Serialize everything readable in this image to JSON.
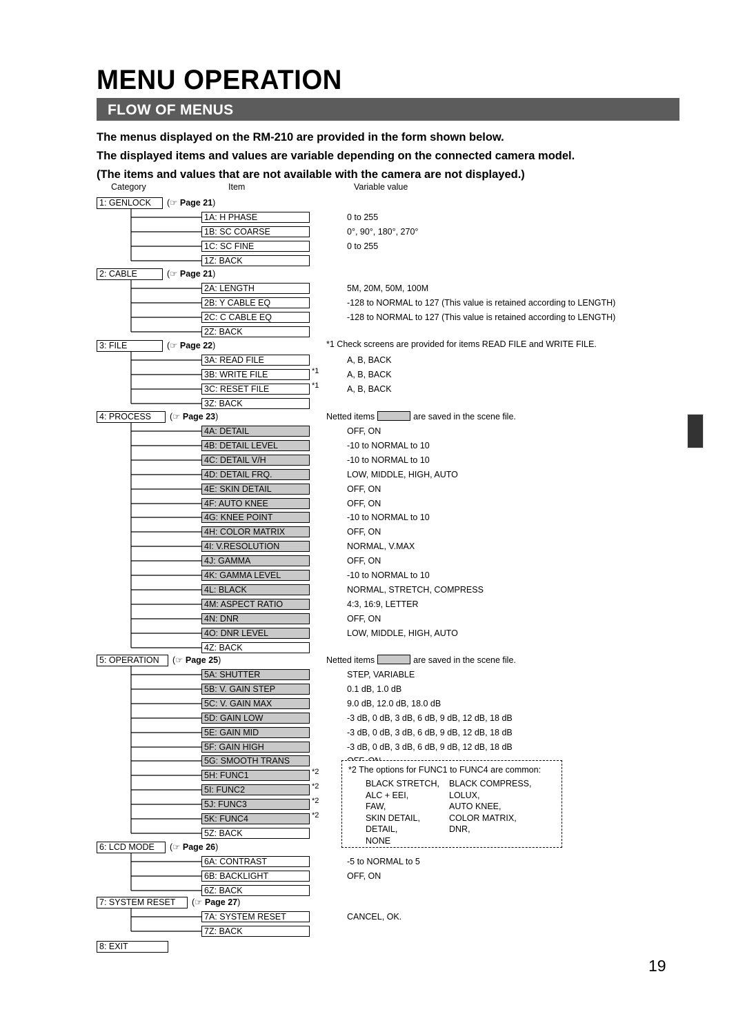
{
  "page": {
    "title": "MENU OPERATION",
    "section_bar_label": "FLOW OF MENUS",
    "section_bar_color": "#5c5c5c",
    "page_number": "19",
    "intro_lines": [
      "The menus displayed on the RM-210 are provided in the form shown below.",
      "The displayed items and values are variable depending on the connected camera model.",
      "(The items and values that are not available with the camera are not displayed.)"
    ],
    "column_headers": {
      "category": "Category",
      "item": "Item",
      "value": "Variable value"
    },
    "netted_colors": {
      "netted_fill": "#c9c9c9",
      "box_border": "#000000"
    }
  },
  "notes": {
    "file_note": "*1 Check screens are provided for items READ FILE and WRITE FILE.",
    "netted_prefix": "Netted items",
    "netted_suffix": "are saved in the scene file.",
    "func_note": {
      "marker": "*2",
      "title": "The options for FUNC1 to FUNC4 are common:",
      "col_a": [
        "BLACK STRETCH,",
        "ALC + EEI,",
        "FAW,",
        "SKIN DETAIL,",
        "DETAIL,",
        "NONE"
      ],
      "col_b": [
        "BLACK COMPRESS,",
        "LOLUX,",
        "AUTO KNEE,",
        "COLOR MATRIX,",
        "DNR,",
        ""
      ]
    }
  },
  "reference_icon": "pointing-hand-icon",
  "menu": [
    {
      "category": "1: GENLOCK",
      "page_ref_prefix": "(",
      "page_ref": "Page 21",
      "page_ref_suffix": ")",
      "items": [
        {
          "label": "1A: H PHASE",
          "value": "0 to 255",
          "netted": false,
          "mark": ""
        },
        {
          "label": "1B: SC COARSE",
          "value": "0°, 90°, 180°, 270°",
          "netted": false,
          "mark": ""
        },
        {
          "label": "1C: SC FINE",
          "value": "0 to 255",
          "netted": false,
          "mark": ""
        },
        {
          "label": "1Z: BACK",
          "value": "",
          "netted": false,
          "mark": ""
        }
      ]
    },
    {
      "category": "2: CABLE",
      "page_ref_prefix": "(",
      "page_ref": "Page 21",
      "page_ref_suffix": ")",
      "items": [
        {
          "label": "2A: LENGTH",
          "value": "5M, 20M, 50M, 100M",
          "netted": false,
          "mark": ""
        },
        {
          "label": "2B: Y CABLE EQ",
          "value": "-128 to NORMAL to 127 (This value is retained according to LENGTH)",
          "netted": false,
          "mark": ""
        },
        {
          "label": "2C: C CABLE EQ",
          "value": "-128 to NORMAL to 127 (This value is retained according to LENGTH)",
          "netted": false,
          "mark": ""
        },
        {
          "label": "2Z: BACK",
          "value": "",
          "netted": false,
          "mark": ""
        }
      ]
    },
    {
      "category": "3: FILE",
      "page_ref_prefix": "(",
      "page_ref": "Page 22",
      "page_ref_suffix": ")",
      "items": [
        {
          "label": "3A: READ FILE",
          "value": "A, B, BACK",
          "netted": false,
          "mark": ""
        },
        {
          "label": "3B: WRITE FILE",
          "value": "A, B, BACK",
          "netted": false,
          "mark": "*1"
        },
        {
          "label": "3C: RESET FILE",
          "value": "A, B, BACK",
          "netted": false,
          "mark": "*1"
        },
        {
          "label": "3Z: BACK",
          "value": "",
          "netted": false,
          "mark": ""
        }
      ]
    },
    {
      "category": "4: PROCESS",
      "page_ref_prefix": "(",
      "page_ref": "Page 23",
      "page_ref_suffix": ")",
      "items": [
        {
          "label": "4A: DETAIL",
          "value": "OFF, ON",
          "netted": true,
          "mark": ""
        },
        {
          "label": "4B: DETAIL LEVEL",
          "value": "-10 to NORMAL to 10",
          "netted": true,
          "mark": ""
        },
        {
          "label": "4C: DETAIL V/H",
          "value": "-10 to NORMAL to 10",
          "netted": true,
          "mark": ""
        },
        {
          "label": "4D: DETAIL FRQ.",
          "value": "LOW, MIDDLE, HIGH, AUTO",
          "netted": true,
          "mark": ""
        },
        {
          "label": "4E: SKIN DETAIL",
          "value": "OFF, ON",
          "netted": true,
          "mark": ""
        },
        {
          "label": "4F: AUTO KNEE",
          "value": "OFF, ON",
          "netted": true,
          "mark": ""
        },
        {
          "label": "4G: KNEE POINT",
          "value": "-10 to NORMAL to 10",
          "netted": true,
          "mark": ""
        },
        {
          "label": "4H: COLOR MATRIX",
          "value": "OFF, ON",
          "netted": true,
          "mark": ""
        },
        {
          "label": "4I: V.RESOLUTION",
          "value": "NORMAL, V.MAX",
          "netted": true,
          "mark": ""
        },
        {
          "label": "4J: GAMMA",
          "value": "OFF, ON",
          "netted": true,
          "mark": ""
        },
        {
          "label": "4K: GAMMA LEVEL",
          "value": "-10 to NORMAL to 10",
          "netted": true,
          "mark": ""
        },
        {
          "label": "4L: BLACK",
          "value": "NORMAL, STRETCH, COMPRESS",
          "netted": true,
          "mark": ""
        },
        {
          "label": "4M: ASPECT RATIO",
          "value": "4:3, 16:9, LETTER",
          "netted": true,
          "mark": ""
        },
        {
          "label": "4N: DNR",
          "value": "OFF, ON",
          "netted": true,
          "mark": ""
        },
        {
          "label": "4O: DNR LEVEL",
          "value": "LOW, MIDDLE, HIGH, AUTO",
          "netted": true,
          "mark": ""
        },
        {
          "label": "4Z: BACK",
          "value": "",
          "netted": false,
          "mark": ""
        }
      ]
    },
    {
      "category": "5: OPERATION",
      "page_ref_prefix": "(",
      "page_ref": "Page 25",
      "page_ref_suffix": ")",
      "items": [
        {
          "label": "5A: SHUTTER",
          "value": "STEP, VARIABLE",
          "netted": true,
          "mark": ""
        },
        {
          "label": "5B: V. GAIN STEP",
          "value": "0.1 dB, 1.0 dB",
          "netted": true,
          "mark": ""
        },
        {
          "label": "5C: V. GAIN MAX",
          "value": "9.0 dB, 12.0 dB, 18.0 dB",
          "netted": true,
          "mark": ""
        },
        {
          "label": "5D: GAIN LOW",
          "value": "-3 dB, 0 dB, 3 dB, 6 dB, 9 dB, 12 dB, 18 dB",
          "netted": true,
          "mark": ""
        },
        {
          "label": "5E: GAIN MID",
          "value": "-3 dB, 0 dB, 3 dB, 6 dB, 9 dB, 12 dB, 18 dB",
          "netted": true,
          "mark": ""
        },
        {
          "label": "5F: GAIN HIGH",
          "value": "-3 dB, 0 dB, 3 dB, 6 dB, 9 dB, 12 dB, 18 dB",
          "netted": true,
          "mark": ""
        },
        {
          "label": "5G: SMOOTH TRANS",
          "value": "OFF, ON",
          "netted": true,
          "mark": ""
        },
        {
          "label": "5H: FUNC1",
          "value": "",
          "netted": true,
          "mark": "*2"
        },
        {
          "label": "5I: FUNC2",
          "value": "",
          "netted": true,
          "mark": "*2"
        },
        {
          "label": "5J: FUNC3",
          "value": "",
          "netted": true,
          "mark": "*2"
        },
        {
          "label": "5K: FUNC4",
          "value": "",
          "netted": true,
          "mark": "*2"
        },
        {
          "label": "5Z: BACK",
          "value": "",
          "netted": false,
          "mark": ""
        }
      ]
    },
    {
      "category": "6: LCD MODE",
      "page_ref_prefix": "(",
      "page_ref": "Page 26",
      "page_ref_suffix": ")",
      "items": [
        {
          "label": "6A: CONTRAST",
          "value": "-5 to NORMAL to 5",
          "netted": false,
          "mark": ""
        },
        {
          "label": "6B: BACKLIGHT",
          "value": "OFF, ON",
          "netted": false,
          "mark": ""
        },
        {
          "label": "6Z: BACK",
          "value": "",
          "netted": false,
          "mark": ""
        }
      ]
    },
    {
      "category": "7: SYSTEM RESET",
      "page_ref_prefix": "(",
      "page_ref": "Page 27",
      "page_ref_suffix": ")",
      "items": [
        {
          "label": "7A: SYSTEM RESET",
          "value": "CANCEL, OK.",
          "netted": false,
          "mark": ""
        },
        {
          "label": "7Z: BACK",
          "value": "",
          "netted": false,
          "mark": ""
        }
      ]
    },
    {
      "category": "8: EXIT",
      "page_ref_prefix": "",
      "page_ref": "",
      "page_ref_suffix": "",
      "items": []
    }
  ]
}
